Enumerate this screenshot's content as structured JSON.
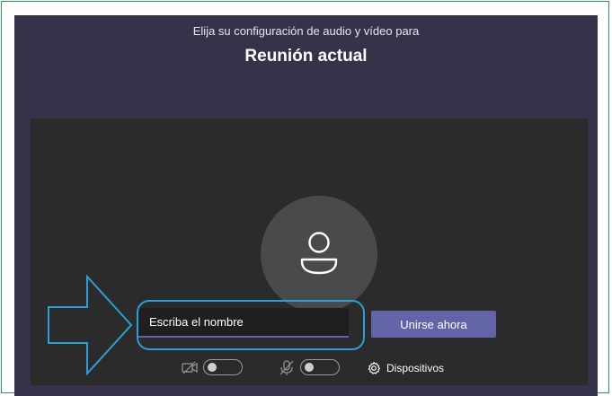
{
  "header": {
    "subtitle": "Elija su configuración de audio y vídeo para",
    "meeting_title": "Reunión actual"
  },
  "name_input": {
    "placeholder": "Escriba el nombre",
    "value": ""
  },
  "join_button": {
    "label": "Unirse ahora"
  },
  "controls": {
    "camera_toggle": {
      "icon": "camera-off-icon",
      "state": "off"
    },
    "mic_toggle": {
      "icon": "mic-off-icon",
      "state": "off"
    },
    "devices": {
      "icon": "gear-icon",
      "label": "Dispositivos"
    }
  },
  "annotations": {
    "arrow_icon": "right-arrow-outline",
    "highlight": "name-input-highlight-oval"
  },
  "colors": {
    "frame_border": "#22a645",
    "app_background": "#34334a",
    "preview_background": "#2b2b2b",
    "accent": "#6264a7",
    "highlight": "#2a9fd8"
  }
}
